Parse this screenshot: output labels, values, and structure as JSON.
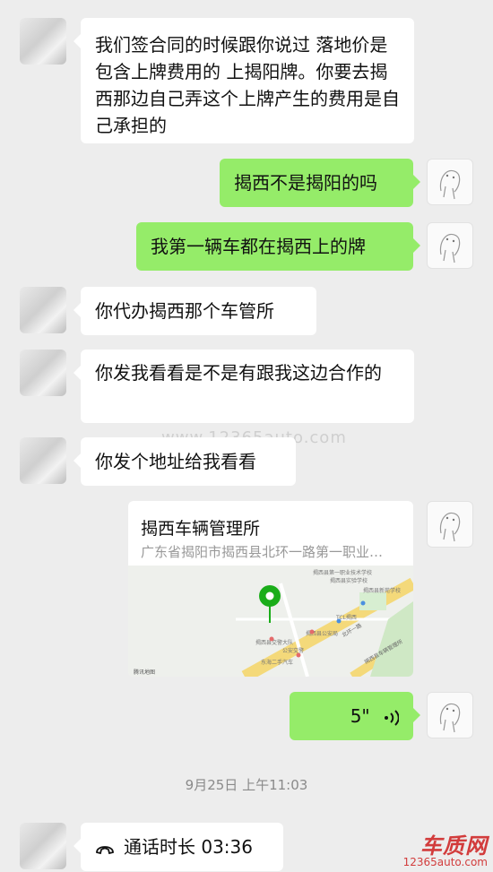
{
  "messages": [
    {
      "side": "left",
      "text": "我们签合同的时候跟你说过 落地价是包含上牌费用的 上揭阳牌。你要去揭西那边自己弄这个上牌产生的费用是自己承担的"
    },
    {
      "side": "right",
      "text": "揭西不是揭阳的吗"
    },
    {
      "side": "right",
      "text": "我第一辆车都在揭西上的牌"
    },
    {
      "side": "left",
      "text": "你代办揭西那个车管所"
    },
    {
      "side": "left",
      "text": "你发我看看是不是有跟我这边合作的"
    },
    {
      "side": "left",
      "text": "你发个地址给我看看"
    }
  ],
  "location": {
    "title": "揭西车辆管理所",
    "address": "广东省揭阳市揭西县北环一路第一职业…",
    "map_provider": "腾讯地图",
    "map_labels": [
      "揭西县第一职业技术学校",
      "揭西县实验学校",
      "揭西县新苑学校",
      "TCL揭西",
      "揭西县公安局",
      "揭西县交警大队",
      "公安交警",
      "东海二手汽车",
      "北环一路",
      "揭西县车辆管理所"
    ]
  },
  "voice": {
    "duration": "5\""
  },
  "timestamp": "9月25日 上午11:03",
  "call": {
    "label": "通话时长 03:36"
  },
  "watermark": "www.12365auto.com",
  "brand": {
    "name": "车质网",
    "url": "12365auto.com"
  }
}
